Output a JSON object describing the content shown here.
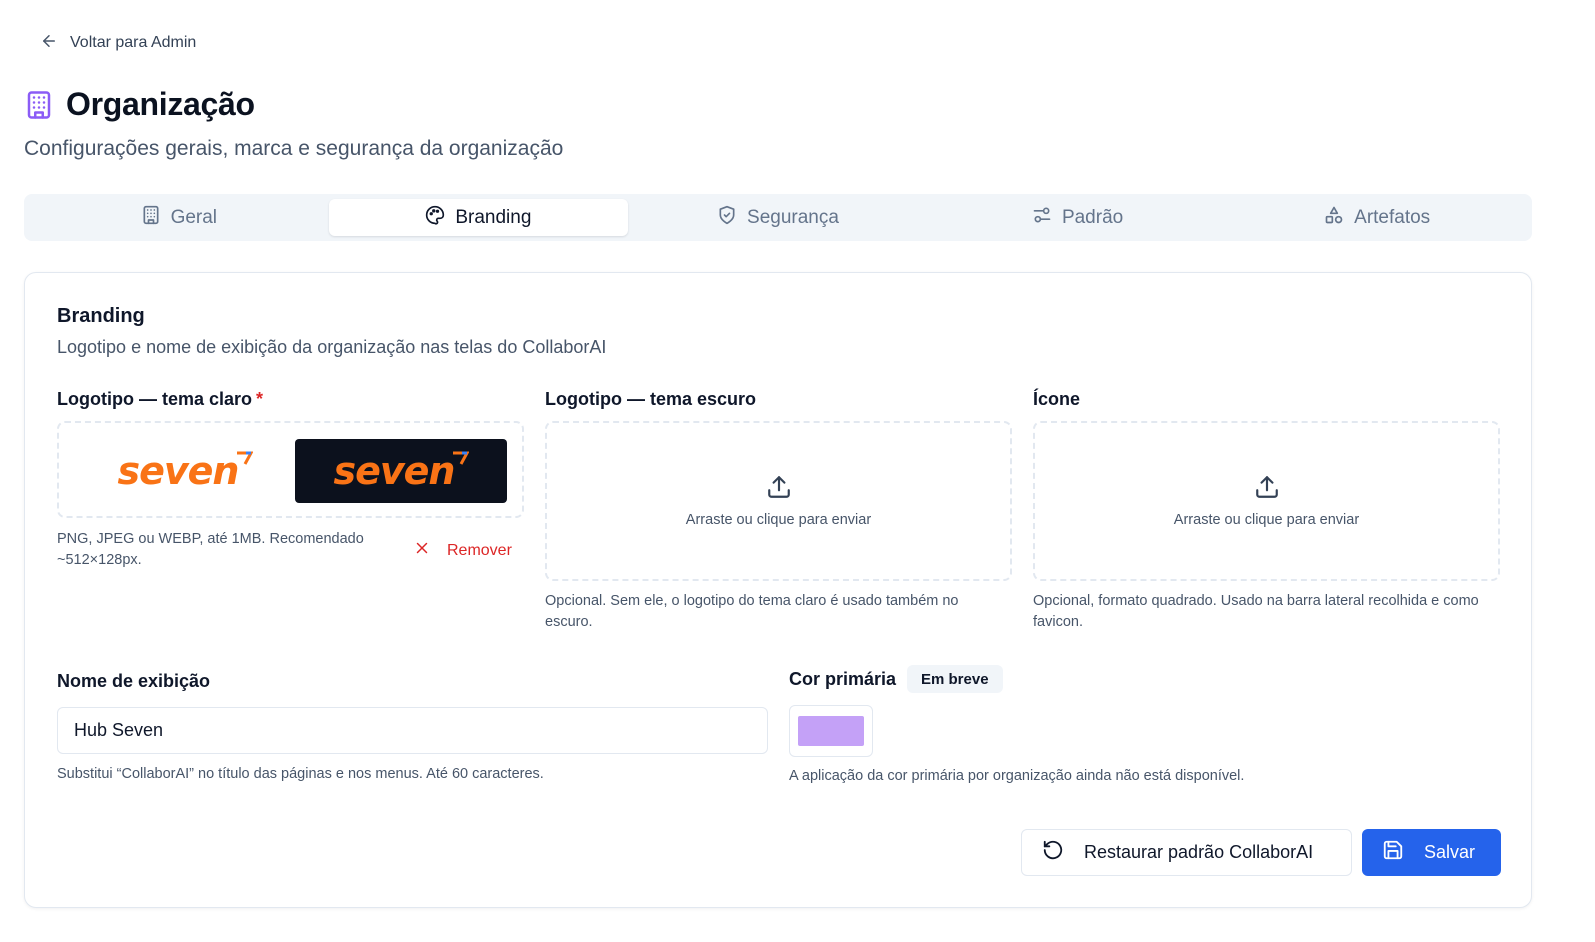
{
  "nav": {
    "back_label": "Voltar para Admin"
  },
  "header": {
    "title": "Organização",
    "subtitle": "Configurações gerais, marca e segurança da organização"
  },
  "tabs": [
    {
      "label": "Geral",
      "icon": "building-icon",
      "active": false
    },
    {
      "label": "Branding",
      "icon": "palette-icon",
      "active": true
    },
    {
      "label": "Segurança",
      "icon": "shield-icon",
      "active": false
    },
    {
      "label": "Padrão",
      "icon": "sliders-icon",
      "active": false
    },
    {
      "label": "Artefatos",
      "icon": "shapes-icon",
      "active": false
    }
  ],
  "branding": {
    "title": "Branding",
    "description": "Logotipo e nome de exibição da organização nas telas do CollaborAI",
    "logo_light": {
      "label": "Logotipo — tema claro",
      "required_mark": "*",
      "wordmark": "seven",
      "hint": "PNG, JPEG ou WEBP, até 1MB. Recomendado ~512×128px.",
      "remove_label": "Remover"
    },
    "logo_dark": {
      "label": "Logotipo — tema escuro",
      "upload_text": "Arraste ou clique para enviar",
      "hint": "Opcional. Sem ele, o logotipo do tema claro é usado também no escuro."
    },
    "icon": {
      "label": "Ícone",
      "upload_text": "Arraste ou clique para enviar",
      "hint": "Opcional, formato quadrado. Usado na barra lateral recolhida e como favicon."
    },
    "display_name": {
      "label": "Nome de exibição",
      "value": "Hub Seven",
      "hint": "Substitui “CollaborAI” no título das páginas e nos menus. Até 60 caracteres."
    },
    "primary_color": {
      "label": "Cor primária",
      "badge": "Em breve",
      "value": "#c4a1f7",
      "hint": "A aplicação da cor primária por organização ainda não está disponível."
    },
    "actions": {
      "reset_label": "Restaurar padrão CollaborAI",
      "save_label": "Salvar"
    }
  },
  "colors": {
    "accent": "#2563eb",
    "brand_orange": "#f97316",
    "danger": "#dc2626",
    "title_icon": "#8b5cf6"
  }
}
